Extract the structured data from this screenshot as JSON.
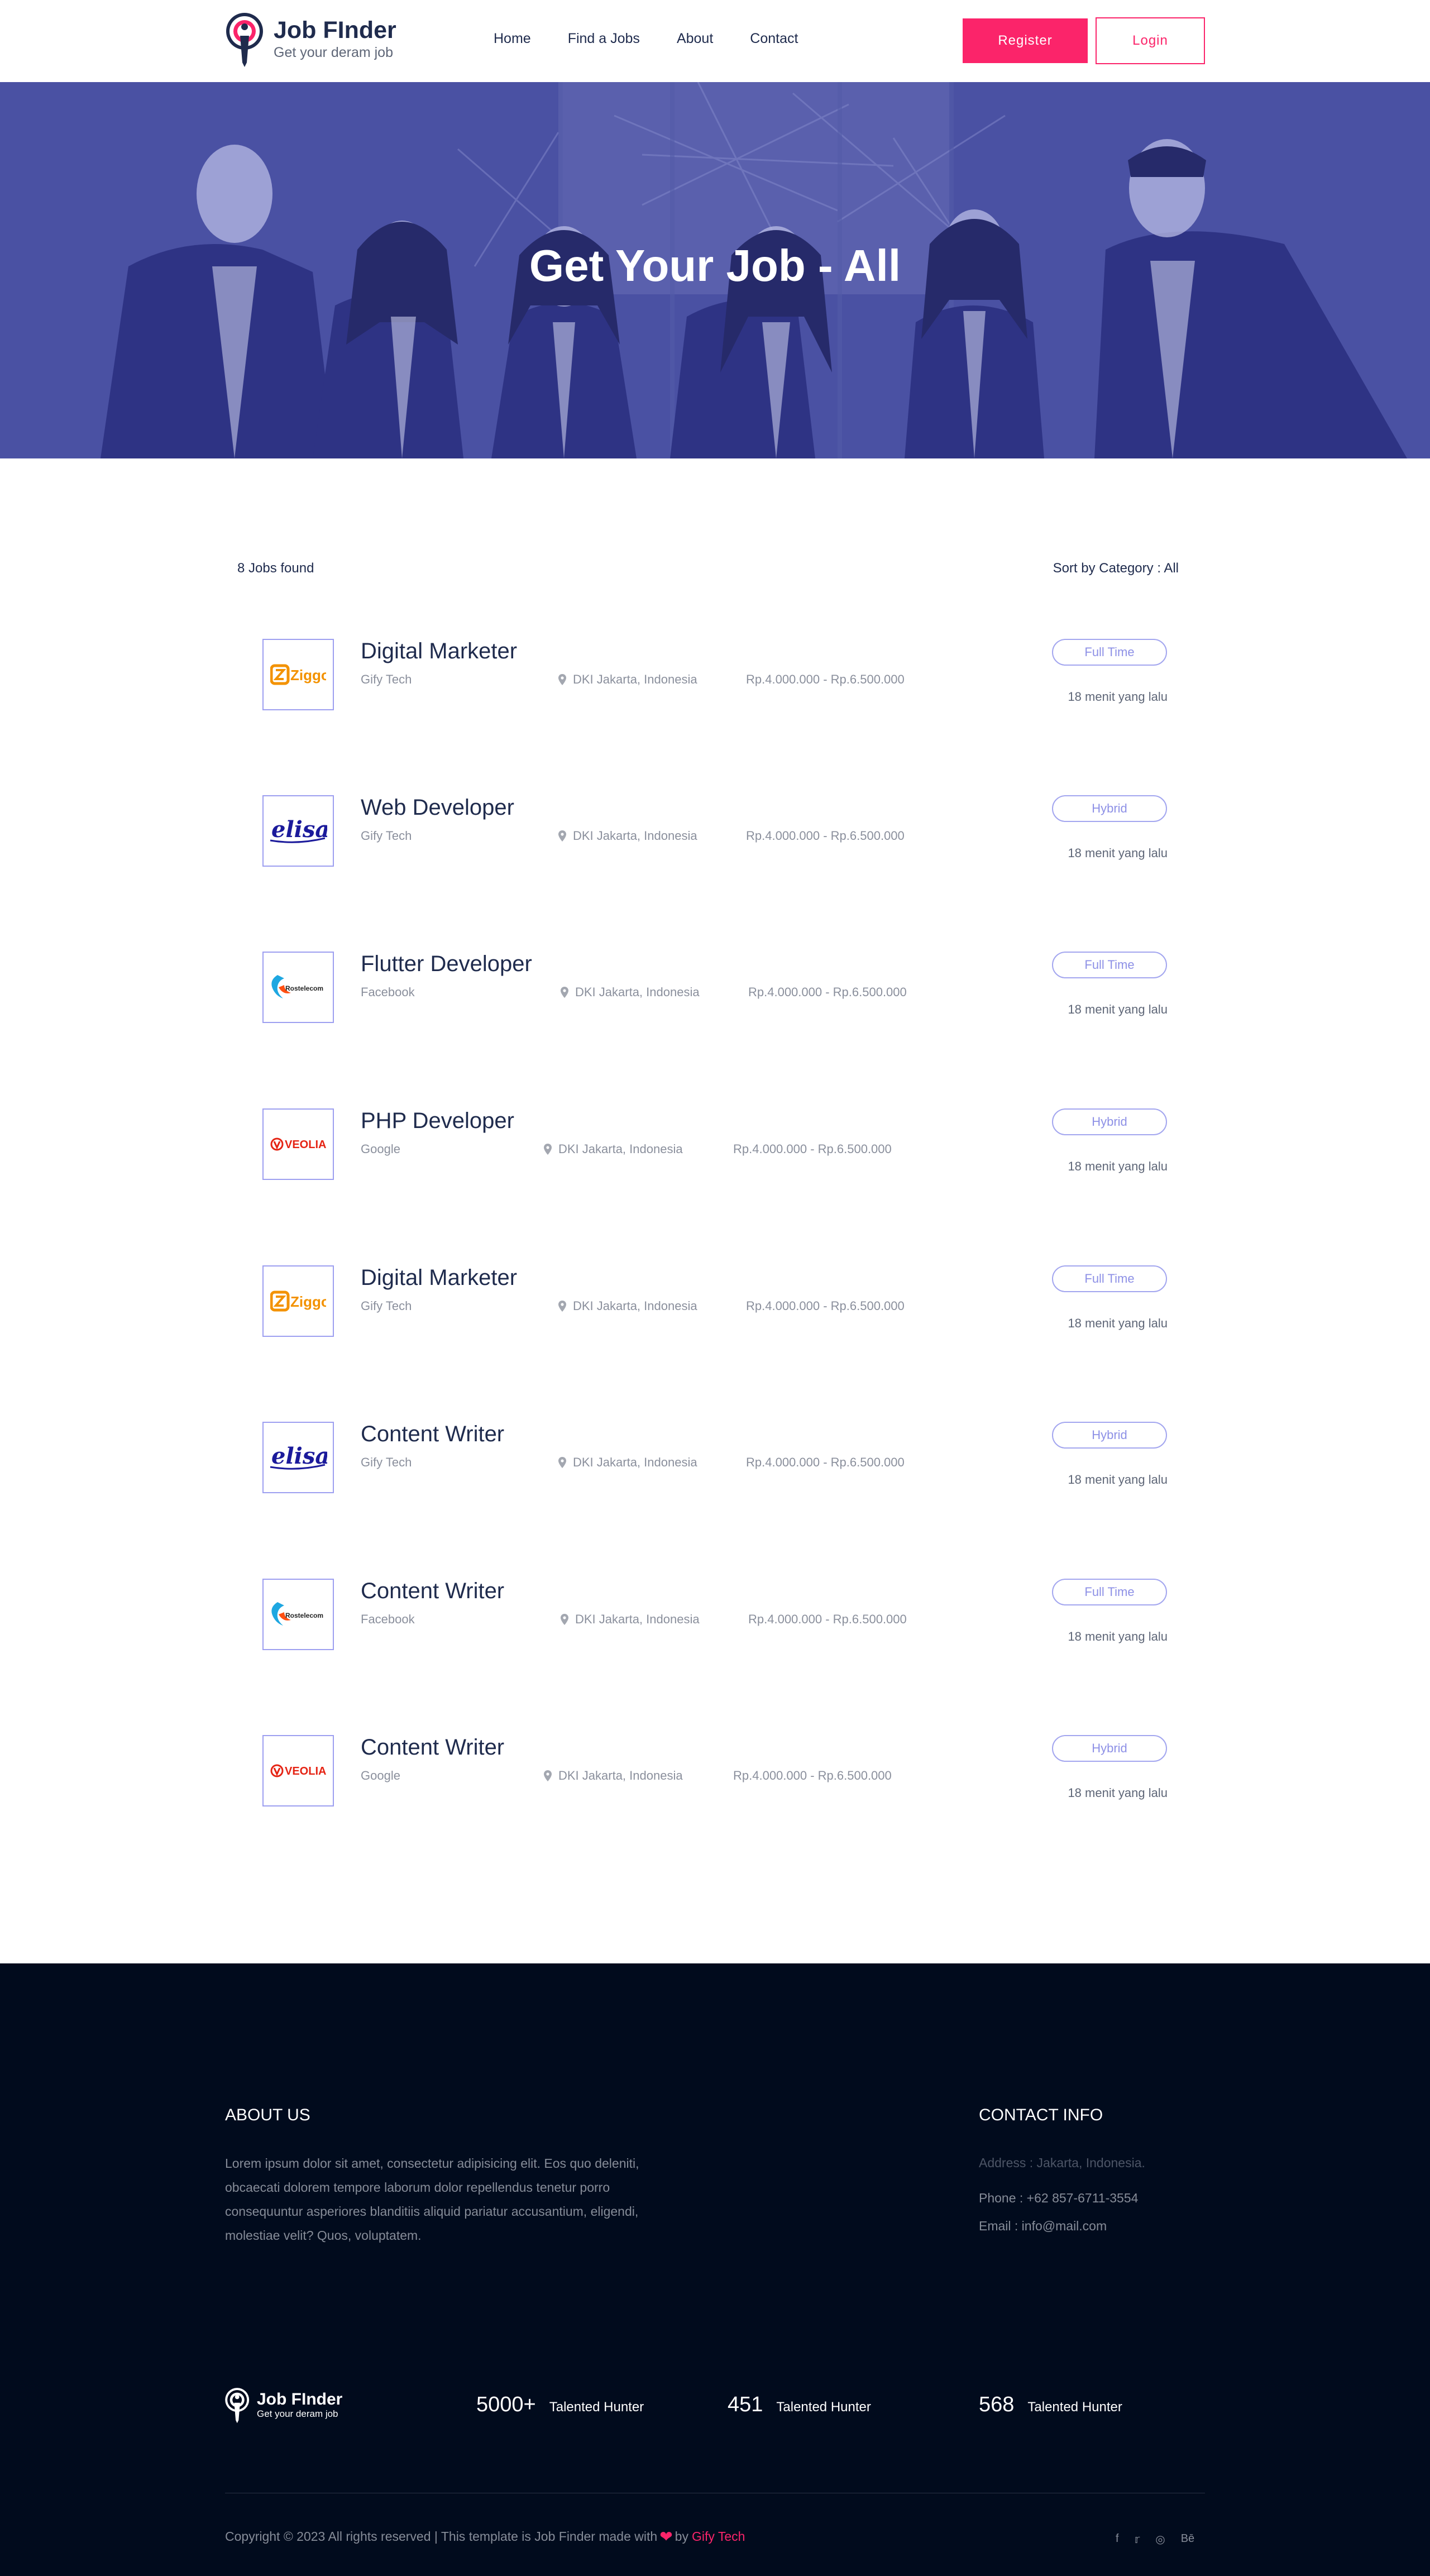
{
  "header": {
    "logo_title": "Job FInder",
    "logo_sub": "Get your deram job",
    "nav": [
      "Home",
      "Find a Jobs",
      "About",
      "Contact"
    ],
    "register_label": "Register",
    "login_label": "Login"
  },
  "hero": {
    "title": "Get Your Job - All"
  },
  "listing": {
    "count": "8 Jobs found",
    "sort": "Sort by Category : All",
    "jobs": [
      {
        "title": "Digital Marketer",
        "company": "Gify Tech",
        "location": "DKI Jakarta, Indonesia",
        "salary": "Rp.4.000.000 - Rp.6.500.000",
        "type": "Full Time",
        "time": "18 menit yang lalu",
        "logo": "ziggo-logo"
      },
      {
        "title": "Web Developer",
        "company": "Gify Tech",
        "location": "DKI Jakarta, Indonesia",
        "salary": "Rp.4.000.000 - Rp.6.500.000",
        "type": "Hybrid",
        "time": "18 menit yang lalu",
        "logo": "elisa-logo"
      },
      {
        "title": "Flutter Developer",
        "company": "Facebook",
        "location": "DKI Jakarta, Indonesia",
        "salary": "Rp.4.000.000 - Rp.6.500.000",
        "type": "Full Time",
        "time": "18 menit yang lalu",
        "logo": "rostelecom-logo"
      },
      {
        "title": "PHP Developer",
        "company": "Google",
        "location": "DKI Jakarta, Indonesia",
        "salary": "Rp.4.000.000 - Rp.6.500.000",
        "type": "Hybrid",
        "time": "18 menit yang lalu",
        "logo": "veolia-logo"
      },
      {
        "title": "Digital Marketer",
        "company": "Gify Tech",
        "location": "DKI Jakarta, Indonesia",
        "salary": "Rp.4.000.000 - Rp.6.500.000",
        "type": "Full Time",
        "time": "18 menit yang lalu",
        "logo": "ziggo-logo"
      },
      {
        "title": "Content Writer",
        "company": "Gify Tech",
        "location": "DKI Jakarta, Indonesia",
        "salary": "Rp.4.000.000 - Rp.6.500.000",
        "type": "Hybrid",
        "time": "18 menit yang lalu",
        "logo": "elisa-logo"
      },
      {
        "title": "Content Writer",
        "company": "Facebook",
        "location": "DKI Jakarta, Indonesia",
        "salary": "Rp.4.000.000 - Rp.6.500.000",
        "type": "Full Time",
        "time": "18 menit yang lalu",
        "logo": "rostelecom-logo"
      },
      {
        "title": "Content Writer",
        "company": "Google",
        "location": "DKI Jakarta, Indonesia",
        "salary": "Rp.4.000.000 - Rp.6.500.000",
        "type": "Hybrid",
        "time": "18 menit yang lalu",
        "logo": "veolia-logo"
      }
    ]
  },
  "logos": {
    "ziggo": "Ziggo",
    "elisa": "elisa",
    "rostelecom": "Rostelecom",
    "veolia": "VEOLIA"
  },
  "footer": {
    "about_title": "ABOUT US",
    "about_text": "Lorem ipsum dolor sit amet, consectetur adipisicing elit. Eos quo deleniti, obcaecati dolorem tempore laborum dolor repellendus tenetur porro consequuntur asperiores blanditiis aliquid pariatur accusantium, eligendi, molestiae velit? Quos, voluptatem.",
    "contact_title": "CONTACT INFO",
    "address": "Address : Jakarta, Indonesia.",
    "phone": "Phone : +62 857-6711-3554",
    "email": "Email : info@mail.com",
    "logo_title": "Job FInder",
    "logo_sub": "Get your deram job",
    "stats": [
      {
        "num": "5000+",
        "label": "Talented Hunter"
      },
      {
        "num": "451",
        "label": "Talented Hunter"
      },
      {
        "num": "568",
        "label": "Talented Hunter"
      }
    ],
    "copyright_pre": "Copyright © 2023 All rights reserved | This template is Job Finder made with",
    "copyright_by": "by",
    "copyright_brand": "Gify Tech",
    "socials": [
      "facebook-icon",
      "twitter-icon",
      "globe-icon",
      "behance-icon"
    ]
  },
  "colors": {
    "accent": "#fb246a",
    "navy": "#1f2b4d",
    "hero_overlay": "#3b3f9a",
    "footer_bg": "#010b1d",
    "badge": "#a3a6ef"
  }
}
